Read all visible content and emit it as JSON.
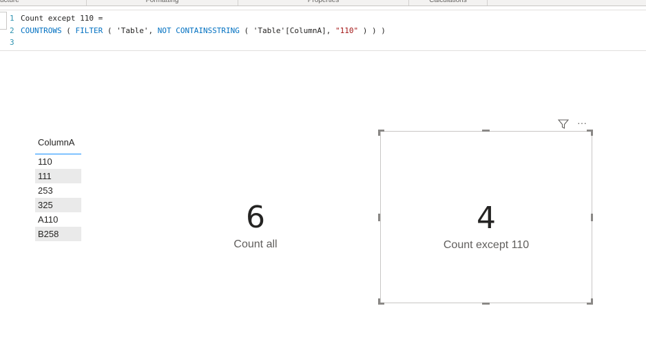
{
  "ribbon": {
    "tabs": [
      "ucture",
      "Formatting",
      "Properties",
      "Calculations"
    ]
  },
  "formula": {
    "lines": [
      {
        "num": "1",
        "text": "Count except 110 ="
      },
      {
        "num": "2",
        "p1": "COUNTROWS",
        "p2": " ( ",
        "p3": "FILTER",
        "p4": " ( 'Table', ",
        "p5": "NOT CONTAINSSTRING",
        "p6": " ( 'Table'[ColumnA], ",
        "p7": "\"110\"",
        "p8": " ) ) )"
      },
      {
        "num": "3",
        "text": ""
      }
    ]
  },
  "table": {
    "header": "ColumnA",
    "rows": [
      "110",
      "111",
      "253",
      "325",
      "A110",
      "B258"
    ]
  },
  "cards": [
    {
      "value": "6",
      "label": "Count all"
    },
    {
      "value": "4",
      "label": "Count except 110"
    }
  ],
  "visual_header": {
    "icons": [
      "filter-icon",
      "more-options-icon"
    ],
    "more_glyph": "···"
  }
}
